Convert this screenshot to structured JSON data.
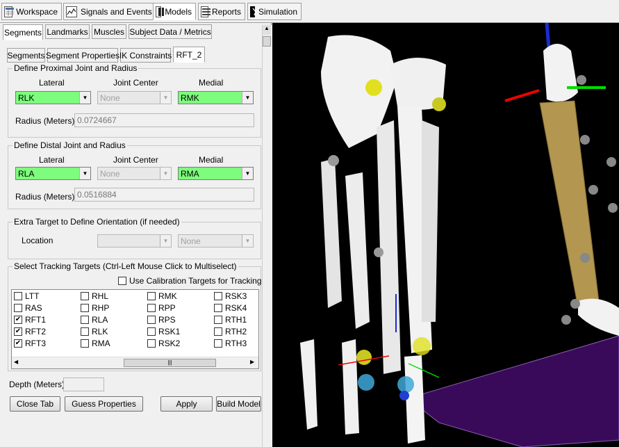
{
  "toolbar": {
    "tabs": [
      {
        "label": "Workspace",
        "icon": "workspace-icon"
      },
      {
        "label": "Signals and Events",
        "icon": "signals-icon"
      },
      {
        "label": "Models",
        "icon": "models-icon"
      },
      {
        "label": "Reports",
        "icon": "reports-icon"
      },
      {
        "label": "Simulation",
        "icon": "simulation-icon"
      }
    ],
    "active": "Models"
  },
  "main_tabs": [
    "Segments",
    "Landmarks",
    "Muscles",
    "Subject Data / Metrics"
  ],
  "sub_tabs": [
    "Segments",
    "Segment Properties",
    "IK Constraints",
    "RFT_2"
  ],
  "proximal": {
    "title": "Define Proximal Joint and Radius",
    "lateral_label": "Lateral",
    "center_label": "Joint Center",
    "medial_label": "Medial",
    "lateral": "RLK",
    "center": "None",
    "medial": "RMK",
    "radius_label": "Radius (Meters)",
    "radius": "0.0724667"
  },
  "distal": {
    "title": "Define Distal Joint and Radius",
    "lateral_label": "Lateral",
    "center_label": "Joint Center",
    "medial_label": "Medial",
    "lateral": "RLA",
    "center": "None",
    "medial": "RMA",
    "radius_label": "Radius (Meters)",
    "radius": "0.0516884"
  },
  "extra": {
    "title": "Extra Target to Define Orientation (if needed)",
    "location_label": "Location",
    "location": "",
    "option": "None"
  },
  "tracking": {
    "title": "Select Tracking Targets (Ctrl-Left Mouse Click to Multiselect)",
    "calibration_label": "Use Calibration Targets for Tracking",
    "calibration_checked": false,
    "columns": [
      [
        {
          "label": "LTT",
          "checked": false
        },
        {
          "label": "RAS",
          "checked": false
        },
        {
          "label": "RFT1",
          "checked": true
        },
        {
          "label": "RFT2",
          "checked": true
        },
        {
          "label": "RFT3",
          "checked": true
        }
      ],
      [
        {
          "label": "RHL",
          "checked": false
        },
        {
          "label": "RHP",
          "checked": false
        },
        {
          "label": "RLA",
          "checked": false
        },
        {
          "label": "RLK",
          "checked": false
        },
        {
          "label": "RMA",
          "checked": false
        }
      ],
      [
        {
          "label": "RMK",
          "checked": false
        },
        {
          "label": "RPP",
          "checked": false
        },
        {
          "label": "RPS",
          "checked": false
        },
        {
          "label": "RSK1",
          "checked": false
        },
        {
          "label": "RSK2",
          "checked": false
        }
      ],
      [
        {
          "label": "RSK3",
          "checked": false
        },
        {
          "label": "RSK4",
          "checked": false
        },
        {
          "label": "RTH1",
          "checked": false
        },
        {
          "label": "RTH2",
          "checked": false
        },
        {
          "label": "RTH3",
          "checked": false
        }
      ]
    ]
  },
  "depth": {
    "label": "Depth (Meters):",
    "value": ""
  },
  "buttons": {
    "close": "Close Tab",
    "guess": "Guess Properties",
    "apply": "Apply",
    "build": "Build Model"
  },
  "viewport": {
    "background": "#000000",
    "bone_color": "#f2f2f2",
    "shank_color": "#b39650",
    "floor_color": "#3a0a5a"
  }
}
